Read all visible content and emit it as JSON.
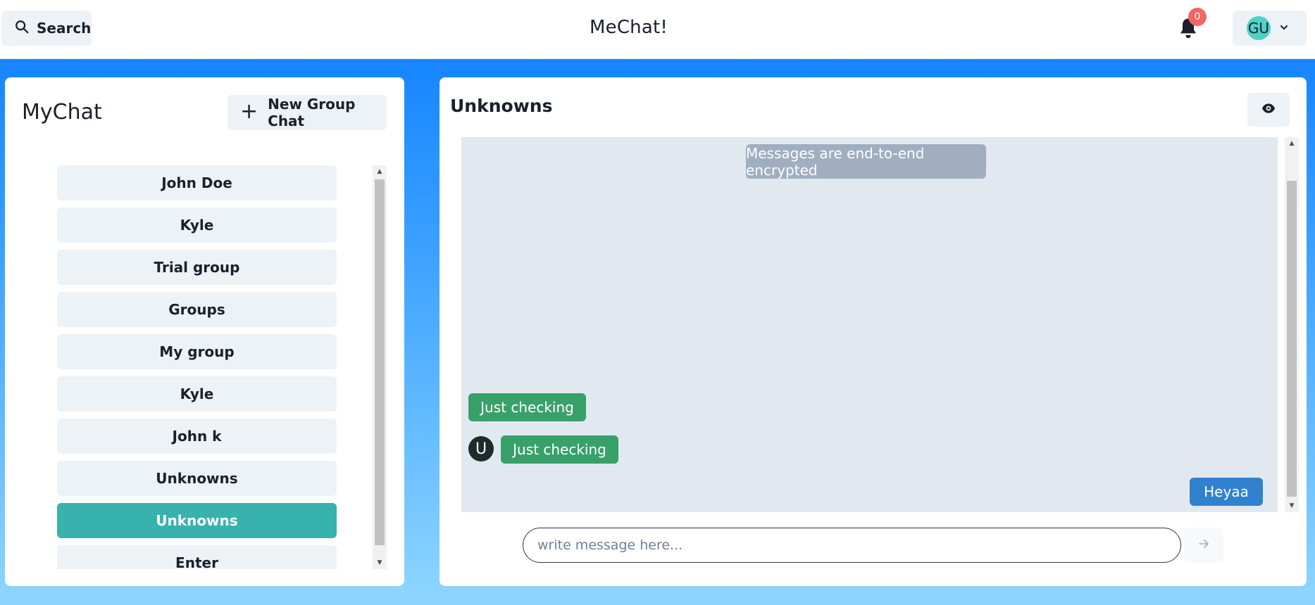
{
  "header": {
    "search_label": "Search",
    "app_title": "MeChat!",
    "notification_count": "0",
    "user_initials": "GU"
  },
  "sidebar": {
    "title": "MyChat",
    "new_group_label": "New Group Chat",
    "chats": [
      {
        "label": "John Doe",
        "active": false
      },
      {
        "label": "Kyle",
        "active": false
      },
      {
        "label": "Trial group",
        "active": false
      },
      {
        "label": "Groups",
        "active": false
      },
      {
        "label": "My group",
        "active": false
      },
      {
        "label": "Kyle",
        "active": false
      },
      {
        "label": "John k",
        "active": false
      },
      {
        "label": "Unknowns",
        "active": false
      },
      {
        "label": "Unknowns",
        "active": true
      },
      {
        "label": "Enter",
        "active": false
      }
    ]
  },
  "chat": {
    "name": "Unknowns",
    "encryption_note": "Messages are end-to-end encrypted",
    "messages": [
      {
        "text": "Just checking",
        "sender": "other"
      },
      {
        "text": "Just checking",
        "sender": "other",
        "avatar": "U"
      },
      {
        "text": "Heyaa",
        "sender": "self"
      }
    ],
    "input_placeholder": "write message here..."
  },
  "colors": {
    "accent_teal": "#38b2ac",
    "bubble_green": "#38a169",
    "bubble_blue": "#3182ce",
    "badge_red": "#f56565",
    "background_blue": "#0a7cff"
  }
}
